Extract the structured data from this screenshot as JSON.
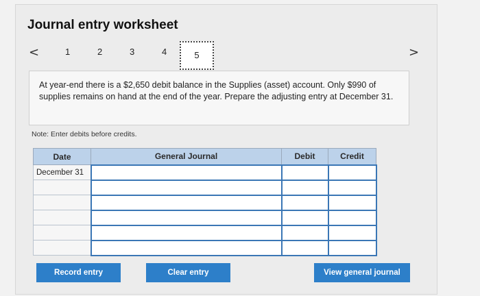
{
  "title": "Journal entry worksheet",
  "pager": {
    "prev": "<",
    "next": ">",
    "pages": [
      "1",
      "2",
      "3",
      "4",
      "5"
    ],
    "active": "5"
  },
  "prompt": "At year-end there is a $2,650 debit balance in the Supplies (asset) account. Only $990 of supplies remains on hand at the end of the year. Prepare the adjusting entry at December 31.",
  "note": "Note: Enter debits before credits.",
  "table": {
    "headers": [
      "Date",
      "General Journal",
      "Debit",
      "Credit"
    ],
    "rows": [
      [
        "December 31",
        "",
        "",
        ""
      ],
      [
        "",
        "",
        "",
        ""
      ],
      [
        "",
        "",
        "",
        ""
      ],
      [
        "",
        "",
        "",
        ""
      ],
      [
        "",
        "",
        "",
        ""
      ],
      [
        "",
        "",
        "",
        ""
      ]
    ]
  },
  "buttons": {
    "record": "Record entry",
    "clear": "Clear entry",
    "view": "View general journal"
  }
}
